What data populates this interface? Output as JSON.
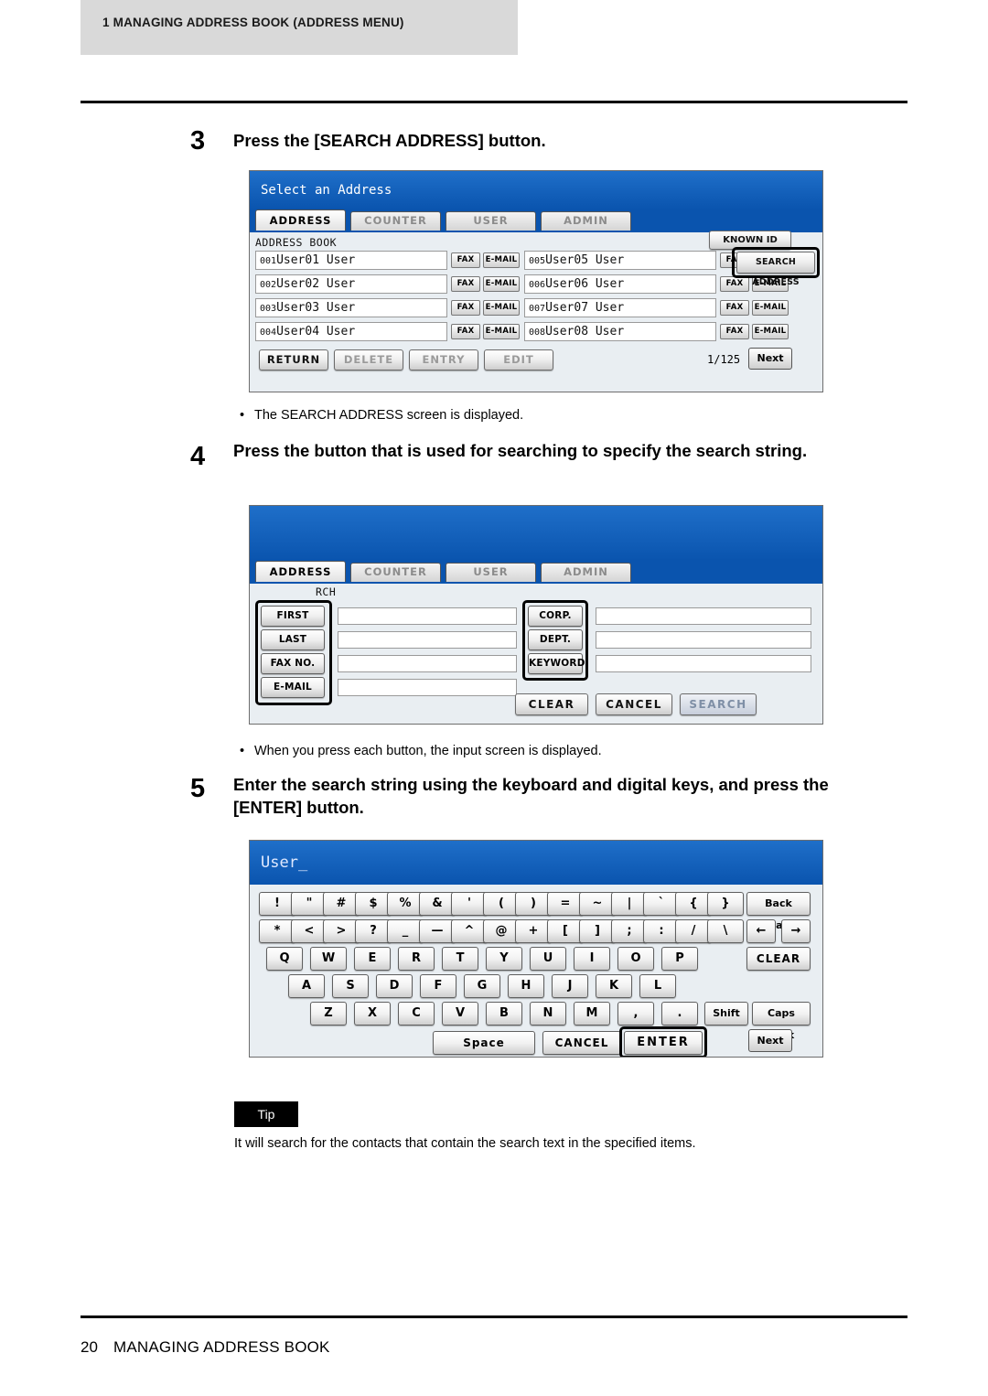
{
  "header": {
    "chapter_label": "1  MANAGING ADDRESS BOOK (ADDRESS MENU)"
  },
  "footer": {
    "page_number": "20",
    "title": "MANAGING ADDRESS BOOK"
  },
  "steps": [
    {
      "num": "3",
      "text": "Press the [SEARCH ADDRESS] button."
    },
    {
      "num": "4",
      "text": "Press the button that is used for searching to specify the search string."
    },
    {
      "num": "5",
      "text": "Enter the search string using the keyboard and digital keys, and press the [ENTER] button."
    }
  ],
  "notes": [
    "The SEARCH ADDRESS screen is displayed.",
    "When you press each button, the input screen is displayed."
  ],
  "tip": {
    "label": "Tip",
    "text": "It will search for the contacts that contain the search text in the specified items."
  },
  "screen_address": {
    "title": "Select an Address",
    "tabs": [
      {
        "label": "ADDRESS",
        "selected": true
      },
      {
        "label": "COUNTER",
        "selected": false
      },
      {
        "label": "USER",
        "selected": false
      },
      {
        "label": "ADMIN",
        "selected": false
      }
    ],
    "section_label": "ADDRESS BOOK",
    "entries": [
      {
        "num": "001",
        "name": "User01 User",
        "fax": "FAX",
        "email": "E-MAIL"
      },
      {
        "num": "002",
        "name": "User02 User",
        "fax": "FAX",
        "email": "E-MAIL"
      },
      {
        "num": "003",
        "name": "User03 User",
        "fax": "FAX",
        "email": "E-MAIL"
      },
      {
        "num": "004",
        "name": "User04 User",
        "fax": "FAX",
        "email": "E-MAIL"
      },
      {
        "num": "005",
        "name": "User05 User",
        "fax": "FAX",
        "email": "E-MAIL"
      },
      {
        "num": "006",
        "name": "User06 User",
        "fax": "FAX",
        "email": "E-MAIL"
      },
      {
        "num": "007",
        "name": "User07 User",
        "fax": "FAX",
        "email": "E-MAIL"
      },
      {
        "num": "008",
        "name": "User08 User",
        "fax": "FAX",
        "email": "E-MAIL"
      }
    ],
    "known_id_button": "KNOWN ID",
    "search_address_button": "SEARCH ADDRESS",
    "bottom_buttons": [
      {
        "label": "RETURN",
        "enabled": true
      },
      {
        "label": "DELETE",
        "enabled": false
      },
      {
        "label": "ENTRY",
        "enabled": false
      },
      {
        "label": "EDIT",
        "enabled": false
      }
    ],
    "page_indicator": "1/125",
    "next_button": "Next"
  },
  "screen_search": {
    "tabs": [
      {
        "label": "ADDRESS",
        "selected": true
      },
      {
        "label": "COUNTER",
        "selected": false
      },
      {
        "label": "USER",
        "selected": false
      },
      {
        "label": "ADMIN",
        "selected": false
      }
    ],
    "section_label": "RCH",
    "left_buttons": [
      "FIRST NAME",
      "LAST NAME",
      "FAX NO.",
      "E-MAIL"
    ],
    "right_buttons": [
      "CORP.",
      "DEPT.",
      "KEYWORD"
    ],
    "action_buttons": [
      {
        "label": "CLEAR",
        "enabled": true
      },
      {
        "label": "CANCEL",
        "enabled": true
      },
      {
        "label": "SEARCH",
        "enabled": false
      }
    ]
  },
  "screen_keyboard": {
    "input_value": "User_",
    "rows": [
      [
        "!",
        "\"",
        "#",
        "$",
        "%",
        "&",
        "'",
        "(",
        ")",
        "=",
        "~",
        "|",
        "`",
        "{",
        "}"
      ],
      [
        "*",
        "<",
        ">",
        "?",
        "_",
        "—",
        "^",
        "@",
        "+",
        "[",
        "]",
        ";",
        ":",
        "/",
        "\\"
      ],
      [
        "Q",
        "W",
        "E",
        "R",
        "T",
        "Y",
        "U",
        "I",
        "O",
        "P"
      ],
      [
        "A",
        "S",
        "D",
        "F",
        "G",
        "H",
        "J",
        "K",
        "L"
      ],
      [
        "Z",
        "X",
        "C",
        "V",
        "B",
        "N",
        "M",
        ",",
        "."
      ]
    ],
    "side_keys": {
      "back_space": "Back Space",
      "arrow_left": "←",
      "arrow_right": "→",
      "clear": "CLEAR",
      "shift": "Shift",
      "caps_lock": "Caps Lock"
    },
    "bottom_keys": {
      "space": "Space",
      "cancel": "CANCEL",
      "enter": "ENTER",
      "next": "Next"
    }
  }
}
